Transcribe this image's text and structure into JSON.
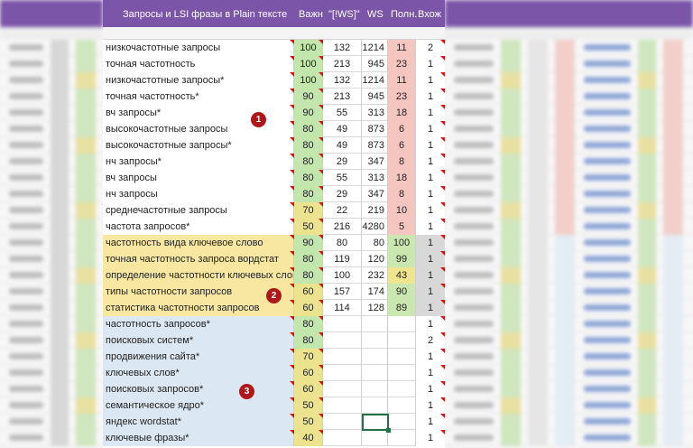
{
  "header": {
    "phrase_col": "Запросы и LSI фразы в Plain тексте",
    "importance_col": "Важн",
    "ws_quoted_col": "\"[!WS]\"",
    "ws_col": "WS",
    "full_col": "Полн.",
    "occurrence_col": "Вхож"
  },
  "colors": {
    "header_bg": "#7b55a8",
    "badge": "#b0171a",
    "group2_bg": "#f8e7a0",
    "group3_bg": "#dbe7f2"
  },
  "badges": [
    "1",
    "2",
    "3"
  ],
  "rows": [
    {
      "phrase": "низкочастотные запросы",
      "imp": "100",
      "ws2": "132",
      "ws": "1214",
      "full": "11",
      "occ": "2",
      "group": 1,
      "impc": "green",
      "fullc": "red"
    },
    {
      "phrase": "точная частотность",
      "imp": "100",
      "ws2": "213",
      "ws": "945",
      "full": "23",
      "occ": "1",
      "group": 1,
      "impc": "green",
      "fullc": "red"
    },
    {
      "phrase": "низкочастотные запросы*",
      "imp": "100",
      "ws2": "132",
      "ws": "1214",
      "full": "11",
      "occ": "1",
      "group": 1,
      "impc": "green",
      "fullc": "red"
    },
    {
      "phrase": "точная частотность*",
      "imp": "90",
      "ws2": "213",
      "ws": "945",
      "full": "23",
      "occ": "1",
      "group": 1,
      "impc": "green",
      "fullc": "red"
    },
    {
      "phrase": "вч запросы*",
      "imp": "90",
      "ws2": "55",
      "ws": "313",
      "full": "18",
      "occ": "1",
      "group": 1,
      "impc": "green",
      "fullc": "red"
    },
    {
      "phrase": "высокочастотные запросы",
      "imp": "80",
      "ws2": "49",
      "ws": "873",
      "full": "6",
      "occ": "1",
      "group": 1,
      "impc": "green",
      "fullc": "red"
    },
    {
      "phrase": "высокочастотные запросы*",
      "imp": "80",
      "ws2": "49",
      "ws": "873",
      "full": "6",
      "occ": "1",
      "group": 1,
      "impc": "green",
      "fullc": "red"
    },
    {
      "phrase": "нч запросы*",
      "imp": "80",
      "ws2": "29",
      "ws": "347",
      "full": "8",
      "occ": "1",
      "group": 1,
      "impc": "green",
      "fullc": "red"
    },
    {
      "phrase": "вч запросы",
      "imp": "80",
      "ws2": "55",
      "ws": "313",
      "full": "18",
      "occ": "1",
      "group": 1,
      "impc": "green",
      "fullc": "red"
    },
    {
      "phrase": "нч запросы",
      "imp": "80",
      "ws2": "29",
      "ws": "347",
      "full": "8",
      "occ": "1",
      "group": 1,
      "impc": "green",
      "fullc": "red"
    },
    {
      "phrase": "среднечастотные запросы",
      "imp": "70",
      "ws2": "22",
      "ws": "219",
      "full": "10",
      "occ": "1",
      "group": 1,
      "impc": "yellow",
      "fullc": "red"
    },
    {
      "phrase": "частота запросов*",
      "imp": "50",
      "ws2": "216",
      "ws": "4280",
      "full": "5",
      "occ": "1",
      "group": 1,
      "impc": "yellow",
      "fullc": "red"
    },
    {
      "phrase": "частотность вида ключевое слово",
      "imp": "90",
      "ws2": "80",
      "ws": "80",
      "full": "100",
      "occ": "1",
      "group": 2,
      "impc": "green",
      "fullc": "green"
    },
    {
      "phrase": "точная частотность запроса вордстат",
      "imp": "80",
      "ws2": "119",
      "ws": "120",
      "full": "99",
      "occ": "1",
      "group": 2,
      "impc": "green",
      "fullc": "green"
    },
    {
      "phrase": "определение частотности ключевых слов",
      "imp": "80",
      "ws2": "100",
      "ws": "232",
      "full": "43",
      "occ": "1",
      "group": 2,
      "impc": "green",
      "fullc": "yellow"
    },
    {
      "phrase": "типы частотности запросов",
      "imp": "60",
      "ws2": "157",
      "ws": "174",
      "full": "90",
      "occ": "1",
      "group": 2,
      "impc": "yellow",
      "fullc": "green"
    },
    {
      "phrase": "статистика частотности запросов",
      "imp": "60",
      "ws2": "114",
      "ws": "128",
      "full": "89",
      "occ": "1",
      "group": 2,
      "impc": "yellow",
      "fullc": "green"
    },
    {
      "phrase": "частотность запросов*",
      "imp": "80",
      "ws2": "",
      "ws": "",
      "full": "",
      "occ": "1",
      "group": 3,
      "impc": "green",
      "fullc": "none"
    },
    {
      "phrase": "поисковых систем*",
      "imp": "80",
      "ws2": "",
      "ws": "",
      "full": "",
      "occ": "2",
      "group": 3,
      "impc": "green",
      "fullc": "none"
    },
    {
      "phrase": "продвижения сайта*",
      "imp": "70",
      "ws2": "",
      "ws": "",
      "full": "",
      "occ": "1",
      "group": 3,
      "impc": "yellow",
      "fullc": "none"
    },
    {
      "phrase": "ключевых слов*",
      "imp": "60",
      "ws2": "",
      "ws": "",
      "full": "",
      "occ": "1",
      "group": 3,
      "impc": "yellow",
      "fullc": "none"
    },
    {
      "phrase": "поисковых запросов*",
      "imp": "60",
      "ws2": "",
      "ws": "",
      "full": "",
      "occ": "1",
      "group": 3,
      "impc": "yellow",
      "fullc": "none"
    },
    {
      "phrase": "семантическое ядро*",
      "imp": "50",
      "ws2": "",
      "ws": "",
      "full": "",
      "occ": "1",
      "group": 3,
      "impc": "yellow",
      "fullc": "none"
    },
    {
      "phrase": "яндекс wordstat*",
      "imp": "50",
      "ws2": "",
      "ws": "",
      "full": "",
      "occ": "1",
      "group": 3,
      "impc": "yellow",
      "fullc": "none"
    },
    {
      "phrase": "ключевые фразы*",
      "imp": "40",
      "ws2": "",
      "ws": "",
      "full": "",
      "occ": "1",
      "group": 3,
      "impc": "yellow",
      "fullc": "none"
    }
  ]
}
